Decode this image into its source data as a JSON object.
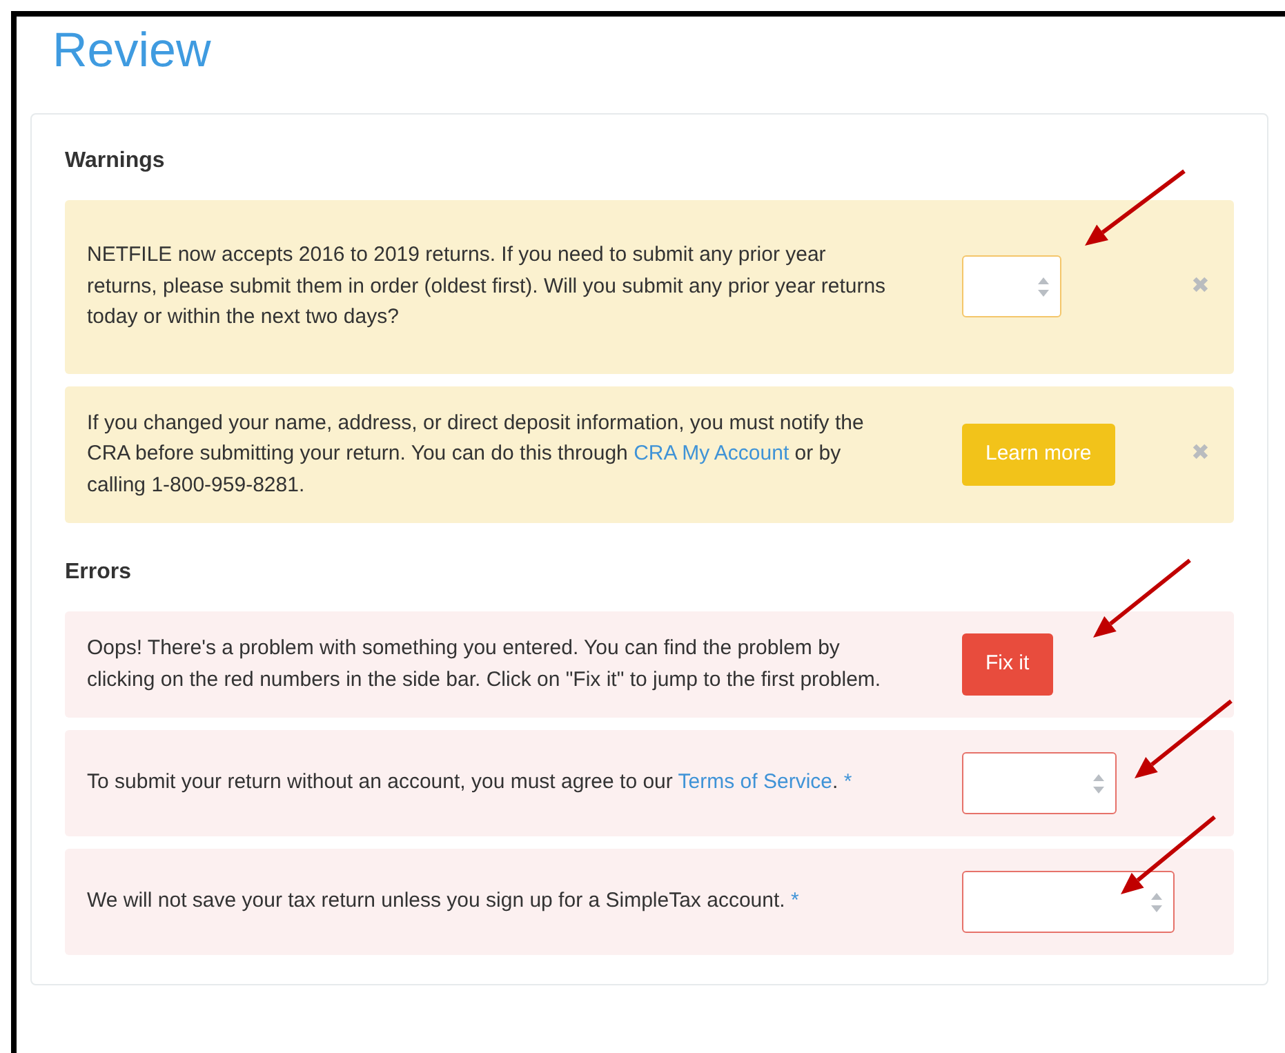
{
  "title": "Review",
  "sections": [
    {
      "heading": "Warnings",
      "kind": "warning",
      "items": [
        {
          "kind": "select",
          "text": "NETFILE now accepts 2016 to 2019 returns. If you need to submit any prior year returns, please submit them in order (oldest first). Will you submit any prior year returns today or within the next two days?",
          "dismiss": "✖"
        },
        {
          "kind": "button",
          "text": "If you changed your name, address, or direct deposit information, you must notify the CRA before submitting your return. You can do this through ",
          "link": "CRA My Account",
          "text_after": " or by calling 1-800-959-8281.",
          "button": "Learn more",
          "dismiss": "✖"
        }
      ]
    },
    {
      "heading": "Errors",
      "kind": "danger",
      "items": [
        {
          "kind": "button",
          "text": "Oops! There's a problem with something you entered. You can find the problem by clicking on the red numbers in the side bar. Click on \"Fix it\" to jump to the first problem.",
          "button": "Fix it"
        },
        {
          "kind": "select",
          "text": "To submit your return without an account, you must agree to our ",
          "link": "Terms of Service",
          "text_after": ".",
          "required_mark": "*"
        },
        {
          "kind": "select",
          "text": "We will not save your tax return unless you sign up for a SimpleTax account.",
          "required_mark": "*"
        }
      ]
    }
  ]
}
